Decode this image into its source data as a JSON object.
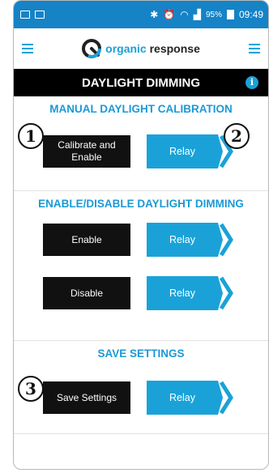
{
  "status_bar": {
    "battery_percent": "95%",
    "time": "09:49"
  },
  "header": {
    "logo_word1": "organic",
    "logo_word2": "response"
  },
  "title": {
    "text": "DAYLIGHT DIMMING",
    "info_glyph": "i"
  },
  "sections": [
    {
      "heading": "MANUAL DAYLIGHT CALIBRATION",
      "rows": [
        {
          "action_label": "Calibrate and\nEnable",
          "relay_label": "Relay"
        }
      ]
    },
    {
      "heading": "ENABLE/DISABLE DAYLIGHT DIMMING",
      "rows": [
        {
          "action_label": "Enable",
          "relay_label": "Relay"
        },
        {
          "action_label": "Disable",
          "relay_label": "Relay"
        }
      ]
    },
    {
      "heading": "SAVE SETTINGS",
      "rows": [
        {
          "action_label": "Save Settings",
          "relay_label": "Relay"
        }
      ]
    }
  ],
  "badges": [
    "1",
    "2",
    "3"
  ],
  "colors": {
    "status_bar": "#1583c6",
    "accent": "#1aa2d8",
    "button_black": "#111111"
  }
}
